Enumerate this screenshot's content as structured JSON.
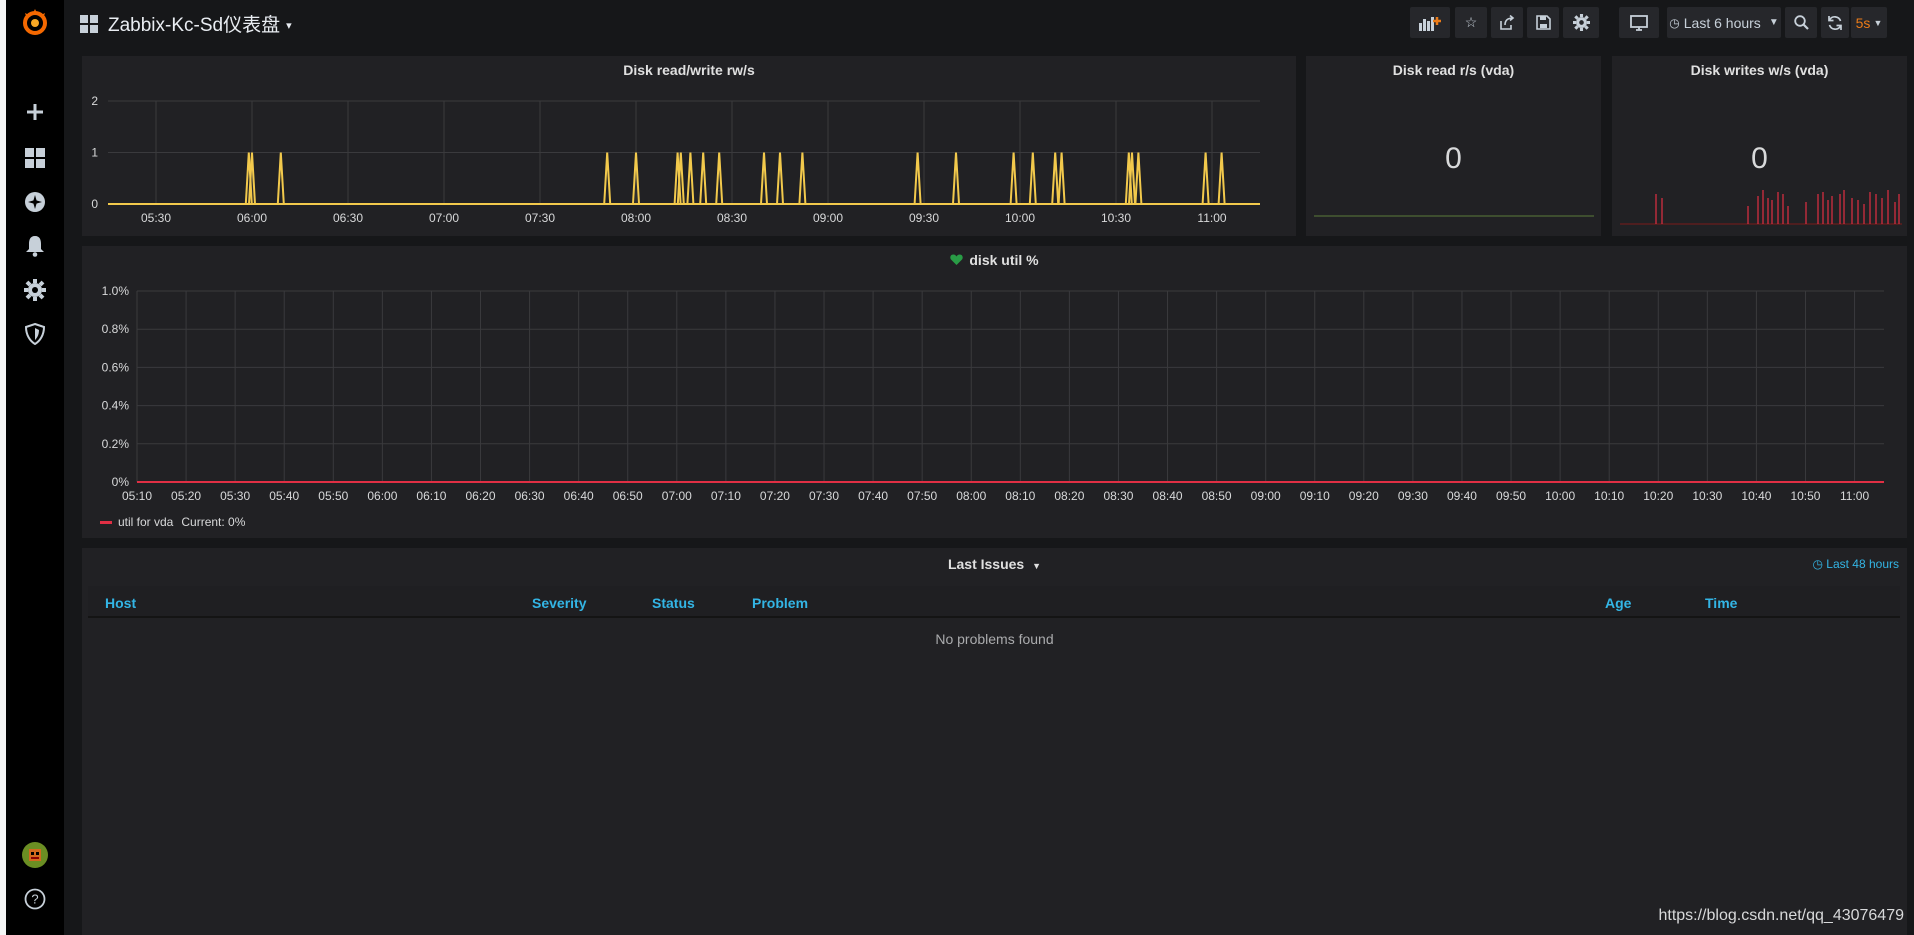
{
  "dashboard": {
    "title": "Zabbix-Kc-Sd仪表盘"
  },
  "toolbar": {
    "time_range_label": "Last 6 hours",
    "refresh_interval": "5s"
  },
  "icons": {
    "logo": "grafana-logo-icon",
    "add": "plus-icon",
    "dashboards": "dashboards-grid-icon",
    "explore": "compass-icon",
    "alerting": "bell-icon",
    "configuration": "gear-icon",
    "server_admin": "shield-icon",
    "help": "question-icon"
  },
  "colors": {
    "accent_yellow": "#f2c94c",
    "series_red": "#e02f44",
    "link_blue": "#33b5e5",
    "refresh_orange": "#eb7b18",
    "health_green": "#299c46"
  },
  "panels": {
    "rw": {
      "title": "Disk read/write rw/s",
      "y_ticks": [
        "2",
        "1",
        "0"
      ],
      "x_ticks": [
        "05:30",
        "06:00",
        "06:30",
        "07:00",
        "07:30",
        "08:00",
        "08:30",
        "09:00",
        "09:30",
        "10:00",
        "10:30",
        "11:00"
      ]
    },
    "read": {
      "title": "Disk read r/s (vda)",
      "value": "0"
    },
    "write": {
      "title": "Disk writes w/s (vda)",
      "value": "0"
    },
    "util": {
      "title": "disk util %",
      "y_ticks": [
        "1.0%",
        "0.8%",
        "0.6%",
        "0.4%",
        "0.2%",
        "0%"
      ],
      "x_ticks": [
        "05:10",
        "05:20",
        "05:30",
        "05:40",
        "05:50",
        "06:00",
        "06:10",
        "06:20",
        "06:30",
        "06:40",
        "06:50",
        "07:00",
        "07:10",
        "07:20",
        "07:30",
        "07:40",
        "07:50",
        "08:00",
        "08:10",
        "08:20",
        "08:30",
        "08:40",
        "08:50",
        "09:00",
        "09:10",
        "09:20",
        "09:30",
        "09:40",
        "09:50",
        "10:00",
        "10:10",
        "10:20",
        "10:30",
        "10:40",
        "10:50",
        "11:00"
      ],
      "legend_series": "util for vda",
      "legend_current": "Current: 0%"
    },
    "issues": {
      "title": "Last Issues",
      "time_override": "Last 48 hours",
      "columns": [
        "Host",
        "Severity",
        "Status",
        "Problem",
        "Age",
        "Time"
      ],
      "empty_text": "No problems found"
    }
  },
  "watermark": "https://blog.csdn.net/qq_43076479",
  "chart_data": [
    {
      "type": "line",
      "title": "Disk read/write rw/s",
      "x_label": "",
      "y_label": "",
      "ylim": [
        0,
        2
      ],
      "x_range": [
        "05:15",
        "11:15"
      ],
      "spikes": [
        {
          "time": "05:59",
          "value": 1
        },
        {
          "time": "06:00",
          "value": 1
        },
        {
          "time": "06:09",
          "value": 1
        },
        {
          "time": "07:51",
          "value": 1
        },
        {
          "time": "08:00",
          "value": 1
        },
        {
          "time": "08:13",
          "value": 1
        },
        {
          "time": "08:14",
          "value": 1
        },
        {
          "time": "08:17",
          "value": 1
        },
        {
          "time": "08:21",
          "value": 1
        },
        {
          "time": "08:26",
          "value": 1
        },
        {
          "time": "08:40",
          "value": 1
        },
        {
          "time": "08:45",
          "value": 1
        },
        {
          "time": "08:52",
          "value": 1
        },
        {
          "time": "09:28",
          "value": 1
        },
        {
          "time": "09:40",
          "value": 1
        },
        {
          "time": "09:58",
          "value": 1
        },
        {
          "time": "10:04",
          "value": 1
        },
        {
          "time": "10:11",
          "value": 1
        },
        {
          "time": "10:13",
          "value": 1
        },
        {
          "time": "10:34",
          "value": 1
        },
        {
          "time": "10:35",
          "value": 1
        },
        {
          "time": "10:37",
          "value": 1
        },
        {
          "time": "10:58",
          "value": 1
        },
        {
          "time": "11:03",
          "value": 1
        }
      ],
      "baseline": 0
    },
    {
      "type": "line",
      "title": "disk util %",
      "series": [
        {
          "name": "util for vda",
          "values": [
            0,
            0
          ]
        }
      ],
      "x_range": [
        "05:10",
        "11:06"
      ],
      "ylim": [
        0,
        1.0
      ],
      "y_unit": "%"
    }
  ]
}
